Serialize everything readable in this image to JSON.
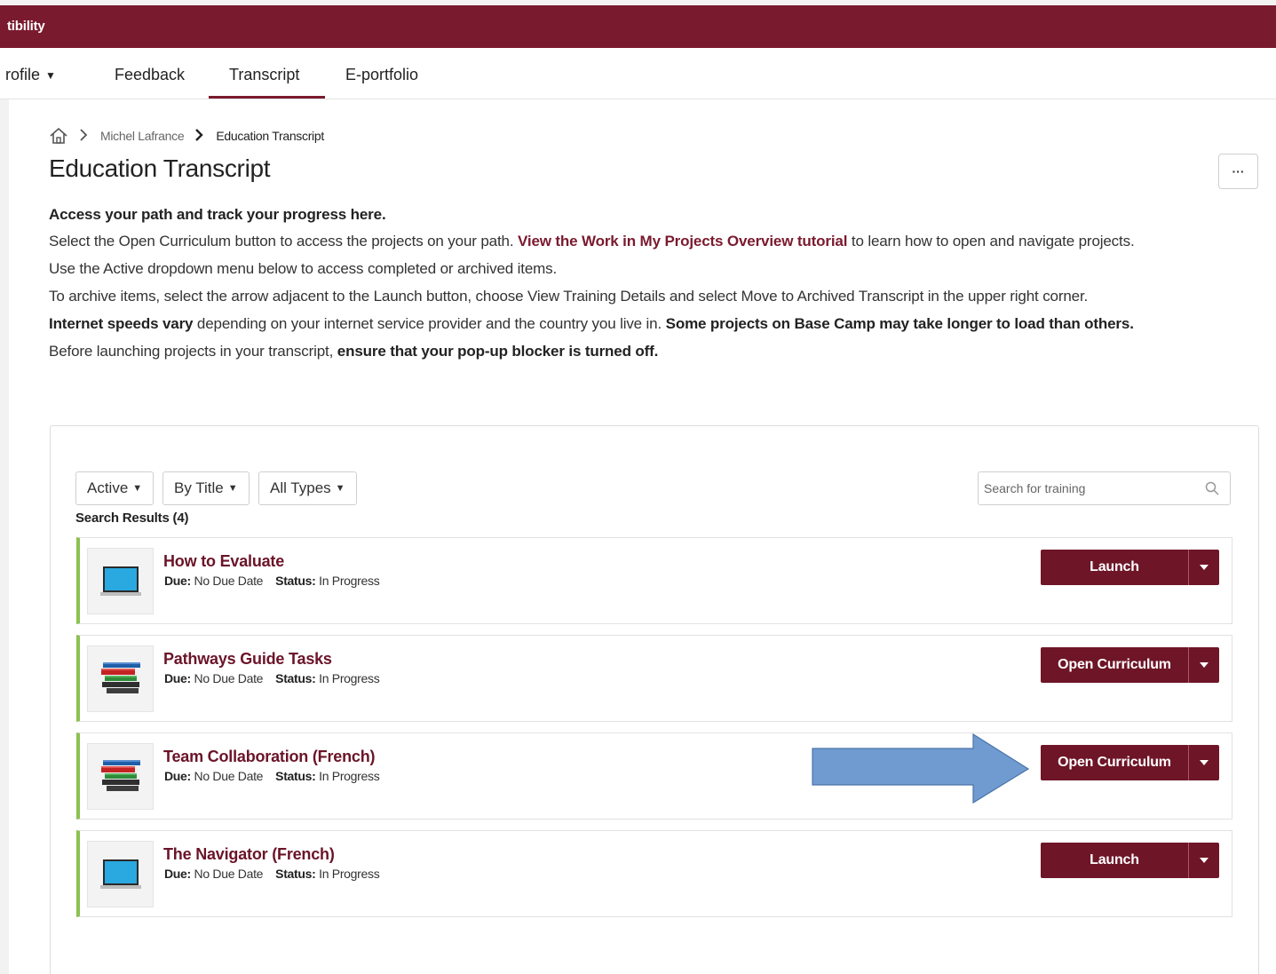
{
  "topbar": {
    "brand": "tibility",
    "color": "#7a1a2e"
  },
  "nav": {
    "items": [
      {
        "label": "rofile",
        "has_caret": true,
        "caret": "▼"
      },
      {
        "label": "Feedback"
      },
      {
        "label": "Transcript",
        "active": true
      },
      {
        "label": "E-portfolio"
      }
    ]
  },
  "breadcrumb": {
    "home_icon": "home-icon",
    "separator": "chevron-right-icon",
    "items": [
      "Michel Lafrance",
      "Education Transcript"
    ]
  },
  "page": {
    "title": "Education Transcript",
    "more_label": "···"
  },
  "intro": {
    "heading": "Access your path and track your progress here.",
    "p1_before": "Select the Open Curriculum button to access the projects on your path. ",
    "p1_link": "View the Work in My Projects Overview tutorial",
    "p1_after": " to learn how to open and navigate projects.",
    "p2": "Use the Active dropdown menu below to access completed or archived items.",
    "p3": "To archive items, select the arrow adjacent to the Launch button, choose View Training Details and select Move to Archived Transcript in the upper right corner.",
    "p4_bold1": "Internet speeds vary",
    "p4_mid": " depending on your internet service provider and the country you live in. ",
    "p4_bold2": "Some projects on Base Camp may take longer to load than others.",
    "p5_before": "Before launching projects in your transcript, ",
    "p5_bold": "ensure that your pop-up blocker is turned off."
  },
  "filters": {
    "status": "Active",
    "sort": "By Title",
    "type": "All Types",
    "caret": "▼"
  },
  "search": {
    "placeholder": "Search for training"
  },
  "results": {
    "label": "Search Results (4)"
  },
  "labels": {
    "due": "Due:",
    "status": "Status:"
  },
  "items": [
    {
      "title": "How to Evaluate",
      "due": "No Due Date",
      "status": "In Progress",
      "icon": "laptop-icon",
      "action": "Launch"
    },
    {
      "title": "Pathways Guide Tasks",
      "due": "No Due Date",
      "status": "In Progress",
      "icon": "books-icon",
      "action": "Open Curriculum"
    },
    {
      "title": "Team Collaboration (French)",
      "due": "No Due Date",
      "status": "In Progress",
      "icon": "books-icon",
      "action": "Open Curriculum"
    },
    {
      "title": "The Navigator (French)",
      "due": "No Due Date",
      "status": "In Progress",
      "icon": "laptop-icon",
      "action": "Launch"
    }
  ],
  "colors": {
    "brand": "#7a1a2e",
    "button": "#6e1527",
    "title_link": "#6b1428",
    "row_accent": "#8cc152",
    "arrow_fill": "#6f9bd0",
    "arrow_stroke": "#4a73a8"
  }
}
